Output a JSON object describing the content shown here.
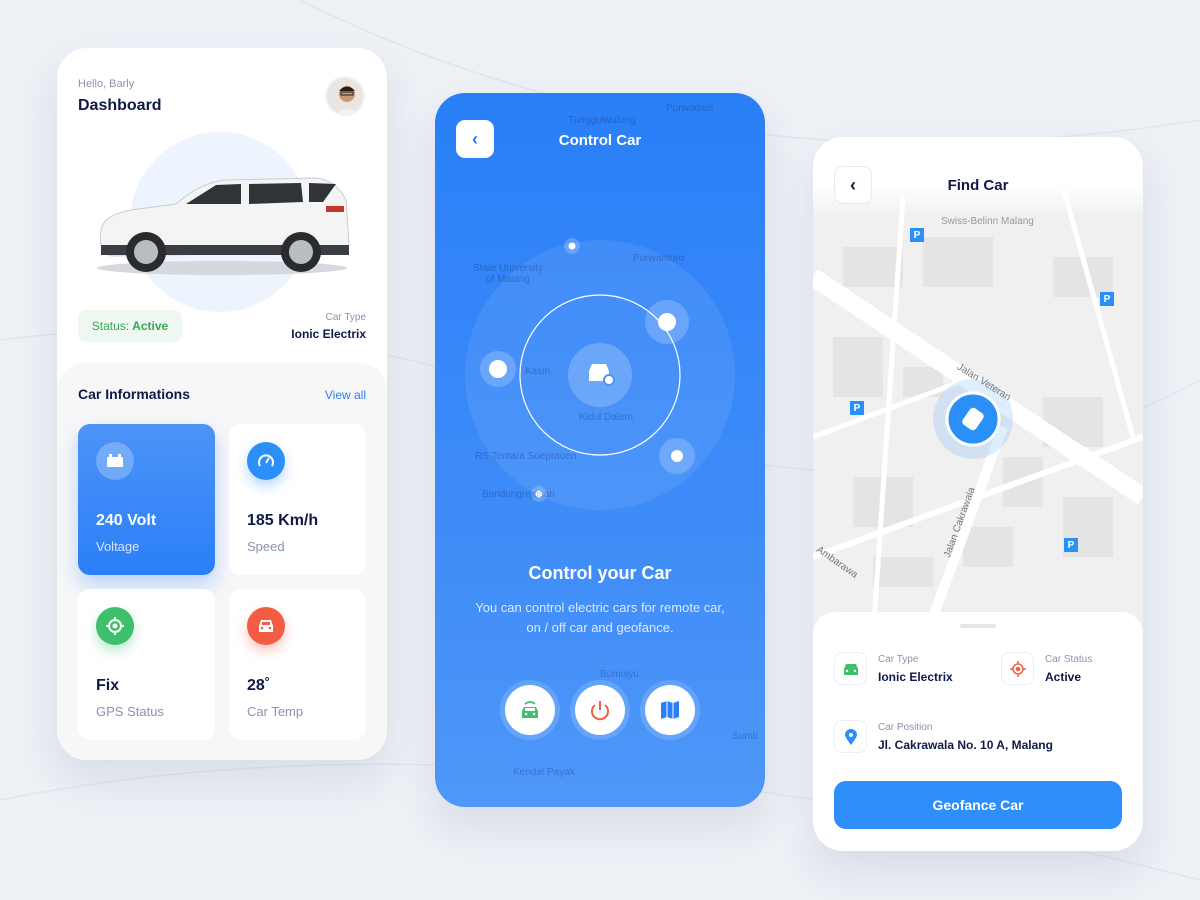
{
  "dashboard": {
    "greeting": "Hello, Barly",
    "title": "Dashboard",
    "status_label": "Status:",
    "status_value": "Active",
    "car_type_label": "Car Type",
    "car_type_value": "Ionic Electrix",
    "section_title": "Car Informations",
    "view_all": "View all",
    "tiles": [
      {
        "value": "240 Volt",
        "label": "Voltage",
        "icon": "battery-icon",
        "color": "#ffffff"
      },
      {
        "value": "185 Km/h",
        "label": "Speed",
        "icon": "speedometer-icon",
        "color": "#2a8ff7"
      },
      {
        "value": "Fix",
        "label": "GPS Status",
        "icon": "gps-target-icon",
        "color": "#3dbf6b"
      },
      {
        "value": "28˚",
        "label": "Car Temp",
        "icon": "car-icon",
        "color": "#f45c43"
      }
    ]
  },
  "control": {
    "title": "Control Car",
    "heading": "Control your Car",
    "description": "You can control electric cars for remote car, on / off car and geofance.",
    "map_labels": [
      "Tunggulwulung",
      "Purwodadi",
      "State University of Malang",
      "Purwantoro",
      "Kasin",
      "Kidul Dalem",
      "RS Tentara Soepraoen",
      "Bandungrejosari",
      "Bumiayu",
      "Kendal Payak",
      "Sumb"
    ],
    "actions": [
      {
        "name": "remote-car",
        "color": "#3dbf6b"
      },
      {
        "name": "power",
        "color": "#f45c43"
      },
      {
        "name": "map",
        "color": "#2a7ff7"
      }
    ]
  },
  "find": {
    "title": "Find Car",
    "map_labels": [
      "Swiss-Belinn Malang",
      "Jalan Veteran",
      "Jalan Cakrawala",
      "Ambarawa"
    ],
    "car_type_label": "Car Type",
    "car_type_value": "Ionic Electrix",
    "car_status_label": "Car Status",
    "car_status_value": "Active",
    "car_position_label": "Car Position",
    "car_position_value": "Jl. Cakrawala No. 10 A, Malang",
    "button": "Geofance Car"
  },
  "colors": {
    "primary": "#2a7ff7",
    "success": "#34a853",
    "danger": "#f45c43",
    "text": "#0f1a4a"
  }
}
